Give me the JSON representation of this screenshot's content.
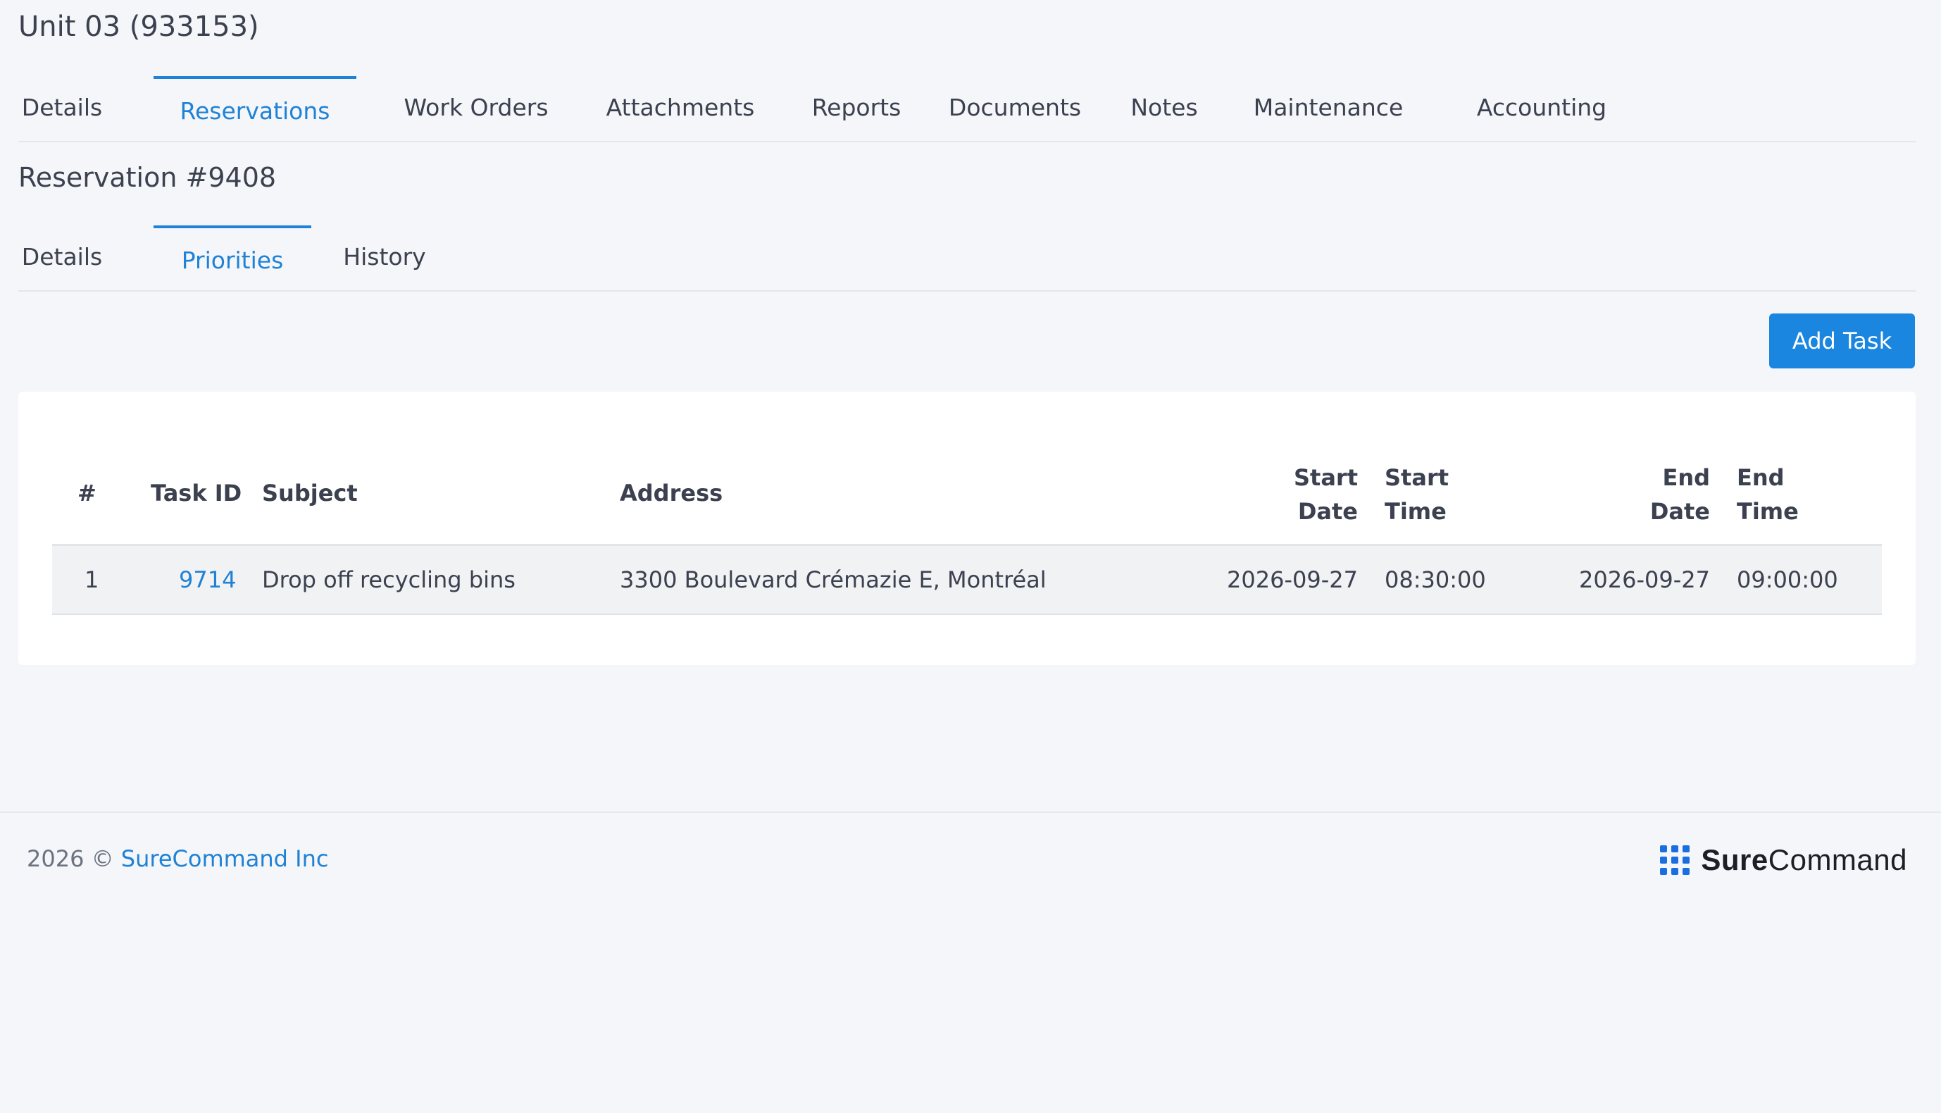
{
  "page_title": "Unit 03 (933153)",
  "main_tabs": [
    {
      "label": "Details"
    },
    {
      "label": "Reservations",
      "active": true
    },
    {
      "label": "Work Orders"
    },
    {
      "label": "Attachments"
    },
    {
      "label": "Reports"
    },
    {
      "label": "Documents"
    },
    {
      "label": "Notes"
    },
    {
      "label": "Maintenance"
    },
    {
      "label": "Accounting"
    }
  ],
  "section_title": "Reservation #9408",
  "sub_tabs": [
    {
      "label": "Details"
    },
    {
      "label": "Priorities",
      "active": true
    },
    {
      "label": "History"
    }
  ],
  "add_task_label": "Add Task",
  "table": {
    "headers": {
      "num": "#",
      "task_id": "Task ID",
      "subject": "Subject",
      "address": "Address",
      "start_date_1": "Start",
      "start_date_2": "Date",
      "start_time_1": "Start",
      "start_time_2": "Time",
      "end_date_1": "End",
      "end_date_2": "Date",
      "end_time_1": "End",
      "end_time_2": "Time"
    },
    "rows": [
      {
        "num": "1",
        "task_id": "9714",
        "subject": "Drop off recycling bins",
        "address": "3300 Boulevard Crémazie E, Montréal",
        "start_date": "2026-09-27",
        "start_time": "08:30:00",
        "end_date": "2026-09-27",
        "end_time": "09:00:00"
      }
    ]
  },
  "footer": {
    "copyright_prefix": "2026 ©",
    "company_link": "SureCommand Inc",
    "brand_part1": "Sure",
    "brand_part2": "Command"
  },
  "colors": {
    "accent": "#1f82d6",
    "button": "#1a86e0",
    "background": "#f4f6f9"
  }
}
